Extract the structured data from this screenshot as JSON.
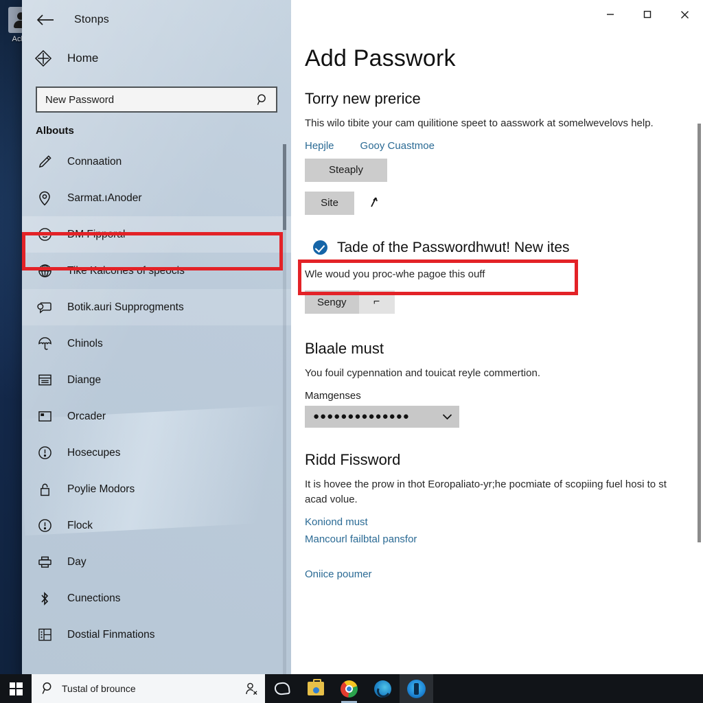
{
  "desktop": {
    "icon_label": "Aclot",
    "icon_name": "user-account-desktop-icon"
  },
  "window": {
    "title": "Stonps",
    "back_icon": "back-arrow-icon",
    "caption": {
      "minimize": "minimize-icon",
      "maximize": "maximize-icon",
      "close": "close-icon"
    }
  },
  "sidebar": {
    "home_label": "Home",
    "home_icon": "home-diamond-icon",
    "search": {
      "value": "New Password",
      "placeholder": "New Password",
      "icon": "search-icon"
    },
    "section_header": "Albouts",
    "items": [
      {
        "label": "Connaation",
        "icon": "pencil-icon",
        "state": "normal"
      },
      {
        "label": "Sarmat.ıAnoder",
        "icon": "location-pin-icon",
        "state": "normal"
      },
      {
        "label": "DM Fipporal",
        "icon": "face-smile-icon",
        "state": "selected"
      },
      {
        "label": "Tike Kalcones of speocis",
        "icon": "globe-icon",
        "state": "normal"
      },
      {
        "label": "Botik.auri Supprogments",
        "icon": "speech-bubble-icon",
        "state": "hovered"
      },
      {
        "label": "Chinols",
        "icon": "umbrella-icon",
        "state": "normal"
      },
      {
        "label": "Diange",
        "icon": "list-panel-icon",
        "state": "normal"
      },
      {
        "label": "Orcader",
        "icon": "window-icon",
        "state": "normal"
      },
      {
        "label": "Hosecupes",
        "icon": "info-circle-icon",
        "state": "normal"
      },
      {
        "label": "Poylie Modors",
        "icon": "lock-icon",
        "state": "normal"
      },
      {
        "label": "Flock",
        "icon": "info-circle-icon",
        "state": "normal"
      },
      {
        "label": "Day",
        "icon": "printer-icon",
        "state": "normal"
      },
      {
        "label": "Cunections",
        "icon": "bluetooth-icon",
        "state": "normal"
      },
      {
        "label": "Dostial Finmations",
        "icon": "apps-grid-icon",
        "state": "normal"
      }
    ]
  },
  "main": {
    "page_title": "Add Passwork",
    "sections": [
      {
        "heading": "Torry new prerice",
        "body": "This wilo tibite your cam quilitione speet to aasswork at somelwevelovs help.",
        "links": [
          "Hepjle",
          "Gooy Cuastmoe"
        ],
        "button": "Steaply"
      }
    ],
    "site_button": "Site",
    "edit_icon": "pencil-edit-icon",
    "highlight": {
      "check_icon": "checkmark-circle-icon",
      "label": "Tade of the Passwordhwut! New ites",
      "sub_text": "Wle woud you proc-whe pagoe this ouff",
      "button": "Sengy",
      "button_secondary_glyph": "⌐",
      "button_secondary_icon": "flag-icon"
    },
    "blaale": {
      "heading": "Blaale must",
      "body": "You fouil cypennation and touicat reyle commertion.",
      "field_label": "Mamgenses",
      "combo_value": "●●●●●●●●●●●●●●",
      "combo_icon": "chevron-down-icon"
    },
    "ridd": {
      "heading": "Ridd Fissword",
      "body": "It is hovee the prow in thot Eoropaliato-yr;he pocmiate of scopiing fuel hosi to st acad volue.",
      "links": [
        "Koniond must",
        "Mancourl failbtal pansfor"
      ],
      "footer_link": "Oniice poumer"
    }
  },
  "annotations": {
    "highlight_color": "#e32227",
    "nav_box_target": "DM Fipporal",
    "check_box_target": "Tade of the Passwordhwut! New ites"
  },
  "taskbar": {
    "start_icon": "windows-start-icon",
    "search": {
      "value": "Tustal of brounce",
      "placeholder": "Tustal of brounce",
      "left_icon": "cortana-search-icon",
      "right_icon": "person-search-icon"
    },
    "apps": [
      {
        "name": "task-view-icon",
        "kind": "cortana",
        "state": "idle"
      },
      {
        "name": "store-icon",
        "kind": "briefcase",
        "state": "idle"
      },
      {
        "name": "chrome-icon",
        "kind": "chrome",
        "state": "running"
      },
      {
        "name": "edge-icon",
        "kind": "edge",
        "state": "idle"
      },
      {
        "name": "blue-app-icon",
        "kind": "blueapp",
        "state": "active"
      }
    ]
  },
  "colors": {
    "accent_link": "#2a6a94",
    "annotation_red": "#e32227",
    "check_blue": "#1565a8",
    "sidebar_bg": "#bccbda",
    "taskbar_bg": "#111418"
  }
}
